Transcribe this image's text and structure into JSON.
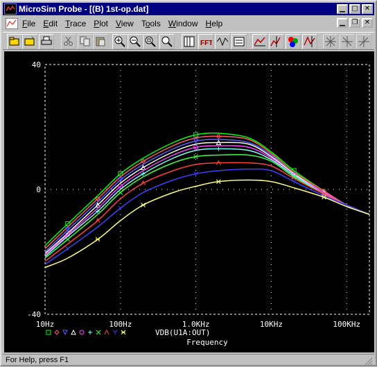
{
  "window": {
    "title": "MicroSim Probe - [(B) 1st-op.dat]"
  },
  "menu": [
    {
      "label": "File",
      "key": "F"
    },
    {
      "label": "Edit",
      "key": "E"
    },
    {
      "label": "Trace",
      "key": "T"
    },
    {
      "label": "Plot",
      "key": "P"
    },
    {
      "label": "View",
      "key": "V"
    },
    {
      "label": "Tools",
      "key": "o"
    },
    {
      "label": "Window",
      "key": "W"
    },
    {
      "label": "Help",
      "key": "H"
    }
  ],
  "toolbar_icons": [
    "open-file-icon",
    "open-folder-icon",
    "print-icon",
    "cut-icon",
    "copy-icon",
    "paste-icon",
    "zoom-in-icon",
    "zoom-out-icon",
    "zoom-area-icon",
    "zoom-fit-icon",
    "axis-settings-icon",
    "fft-icon",
    "performance-analysis-icon",
    "goal-function-icon",
    "toggle-cursor-icon",
    "cursor-peak-icon",
    "mark-label-icon",
    "add-trace-icon",
    "cursor-trough-icon",
    "cursor-slope-icon",
    "cursor-min-icon"
  ],
  "status": {
    "text": "For Help, press F1"
  },
  "chart_data": {
    "type": "line",
    "x_scale": "log",
    "xlim": [
      10,
      200000
    ],
    "ylim": [
      -40,
      40
    ],
    "yticks": [
      "40",
      "0",
      "-40"
    ],
    "xticks": [
      "10Hz",
      "100Hz",
      "1.0KHz",
      "10KHz",
      "100KHz"
    ],
    "xlabel": "Frequency",
    "legend_label": "VDB(U1A:OUT)",
    "grid": true,
    "x": [
      10,
      20,
      50,
      100,
      200,
      500,
      1000,
      2000,
      5000,
      10000,
      20000,
      50000,
      100000,
      200000
    ],
    "series": [
      {
        "color": "#00ff00",
        "marker": "square",
        "values": [
          -18,
          -11,
          -2,
          5,
          10,
          15,
          17.5,
          18,
          16.5,
          12,
          6,
          -0.5,
          -5,
          -8
        ]
      },
      {
        "color": "#ff6060",
        "marker": "diamond",
        "values": [
          -19,
          -12,
          -3,
          4,
          9,
          14,
          16.5,
          17,
          16,
          11.5,
          5.5,
          -0.5,
          -5,
          -8
        ]
      },
      {
        "color": "#6060ff",
        "marker": "triangle-down",
        "values": [
          -20,
          -13,
          -4,
          3,
          8,
          13,
          15.5,
          16,
          15,
          11,
          5,
          -1,
          -5,
          -8
        ]
      },
      {
        "color": "#ffffff",
        "marker": "triangle",
        "values": [
          -20.5,
          -14,
          -5,
          2,
          7,
          12,
          14.5,
          15,
          14.5,
          10.5,
          5,
          -1,
          -5,
          -8
        ]
      },
      {
        "color": "#ff40ff",
        "marker": "circle",
        "values": [
          -21,
          -14.5,
          -6,
          1,
          6,
          11,
          13.5,
          14,
          13.5,
          10,
          4.5,
          -1,
          -5,
          -8
        ]
      },
      {
        "color": "#80ffff",
        "marker": "plus",
        "values": [
          -21.5,
          -15,
          -7,
          0,
          5,
          10,
          12.5,
          13,
          12.5,
          9.5,
          4.5,
          -1.5,
          -5,
          -8
        ]
      },
      {
        "color": "#40ff40",
        "marker": "x",
        "values": [
          -22,
          -16,
          -8,
          -1,
          4,
          8.5,
          10.5,
          11,
          11,
          9,
          4,
          -1.5,
          -5,
          -8
        ]
      },
      {
        "color": "#ff4040",
        "marker": "caret",
        "values": [
          -23,
          -17.5,
          -10,
          -3,
          2,
          6,
          8,
          8.5,
          8.5,
          7.5,
          3.5,
          -1.5,
          -5,
          -8
        ]
      },
      {
        "color": "#4040ff",
        "marker": "y",
        "values": [
          -24,
          -19,
          -12,
          -6,
          -1,
          3,
          5,
          6,
          6.5,
          6,
          2.5,
          -2,
          -5,
          -8
        ]
      },
      {
        "color": "#ffff80",
        "marker": "asterisk",
        "values": [
          -25,
          -22,
          -16,
          -10,
          -5,
          -1,
          1,
          2.5,
          3,
          2.5,
          0.5,
          -2.5,
          -5.5,
          -8
        ]
      }
    ]
  }
}
